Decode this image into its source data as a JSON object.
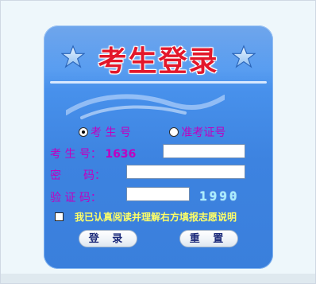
{
  "title": "考生登录",
  "login_type": {
    "options": [
      {
        "label": "考 生 号",
        "selected": true
      },
      {
        "label": "准考证号",
        "selected": false
      }
    ]
  },
  "fields": {
    "exam_number": {
      "label": "考 生 号：",
      "prefix": "1636",
      "value": ""
    },
    "password": {
      "label": "密　　码：",
      "value": ""
    },
    "captcha_input": {
      "label": "验 证 码：",
      "value": ""
    }
  },
  "captcha_code": "1990",
  "agree": {
    "checked": false,
    "text": "我已认真阅读并理解右方填报志愿说明"
  },
  "buttons": {
    "login": "登 录",
    "reset": "重 置"
  },
  "colors": {
    "panel": "#3f88e6",
    "title": "#e3172a",
    "label": "#c000c0",
    "agree_text": "#ffff66",
    "captcha": "#a9eefd"
  },
  "icons": {
    "left": "star-icon",
    "right": "star-icon"
  }
}
